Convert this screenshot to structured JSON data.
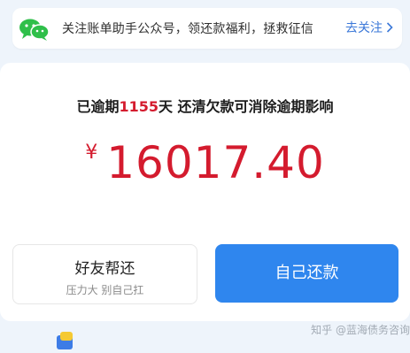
{
  "notice": {
    "icon": "wechat-icon",
    "text": "关注账单助手公众号，领还款福利，拯救征信",
    "follow_label": "去关注",
    "follow_icon": "chevron-right-icon",
    "accent_color": "#3b78d8"
  },
  "status": {
    "prefix": "已逾期",
    "days": "1155",
    "suffix": "天 还清欠款可消除逾期影响"
  },
  "amount": {
    "currency": "¥",
    "value": "16017.40",
    "color": "#d41b2e"
  },
  "buttons": {
    "friend_label": "好友帮还",
    "friend_sub": "压力大 别自己扛",
    "self_label": "自己还款",
    "self_color": "#2f86ee"
  },
  "watermark": "知乎 @蓝海债务咨询"
}
